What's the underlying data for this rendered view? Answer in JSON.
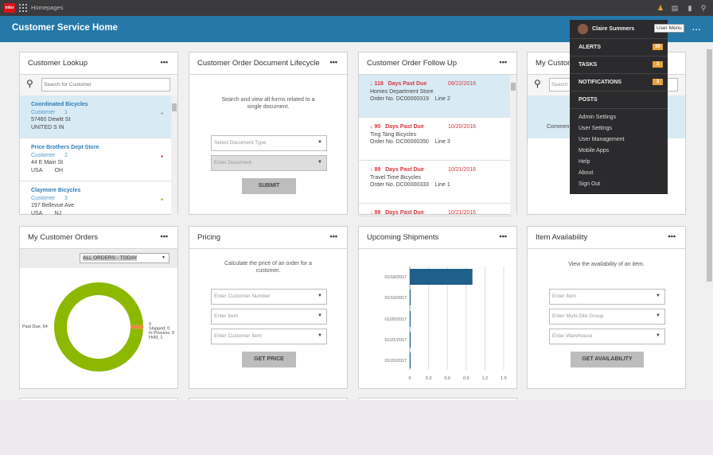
{
  "topbar": {
    "logo": "infor",
    "app_label": "Homepages",
    "icons": [
      "user-icon",
      "chat-icon",
      "bookmark-icon",
      "search-icon"
    ]
  },
  "header": {
    "title": "Customer Service Home",
    "more": "..."
  },
  "colors": {
    "header": "#2578a8",
    "topbar": "#3b3b3d",
    "accent": "#e8a33c",
    "donut_main": "#8cb800",
    "donut_hold": "#f08a3c",
    "bar": "#1f5f8b"
  },
  "cards": {
    "lookup": {
      "title": "Customer Lookup",
      "search_placeholder": "Search for Customer",
      "items": [
        {
          "name": "Coordinated Bicycles",
          "type": "Customer",
          "num": "1",
          "addr": "57460 Dewitt St",
          "region": "UNITED S IN",
          "logo": "COORDINATED BICYCLES"
        },
        {
          "name": "Price Brothers Dept Store",
          "type": "Customer",
          "num": "2",
          "addr": "44 E Main St",
          "region": "USA        OH",
          "logo": "Price Brothers"
        },
        {
          "name": "Claymore Bicycles",
          "type": "Customer",
          "num": "3",
          "addr": "197 Bellevue Ave",
          "region": "USA        NJ",
          "logo": "Claymore BICYCLES"
        }
      ]
    },
    "lifecycle": {
      "title": "Customer Order Document Lifecycle",
      "desc": "Search and view all forms related to a single document.",
      "doc_type": "Select Document Type",
      "doc": "Enter Document",
      "submit": "SUBMIT"
    },
    "followup": {
      "title": "Customer Order Follow Up",
      "items": [
        {
          "days": "118",
          "label": "Days Past Due",
          "date": "09/22/2016",
          "customer": "Homes Department Store",
          "order": "Order No.  DC00000319",
          "line": "Line   2"
        },
        {
          "days": "90",
          "label": "Days Past Due",
          "date": "10/20/2016",
          "customer": "Ting Tang Bicycles",
          "order": "Order No.  DC00000350",
          "line": "Line   3"
        },
        {
          "days": "89",
          "label": "Days Past Due",
          "date": "10/21/2016",
          "customer": "Travel Time Bicycles",
          "order": "Order No.  DC00000333",
          "line": "Line   1"
        },
        {
          "days": "89",
          "label": "Days Past Due",
          "date": "10/21/2016"
        }
      ]
    },
    "mycust": {
      "title": "My Custom",
      "search": "Search",
      "comment": "Commen"
    },
    "orders": {
      "title": "My Customer Orders",
      "filter": "ALL ORDERS - TODAY"
    },
    "pricing": {
      "title": "Pricing",
      "desc": "Calculate the price of an order for a customer.",
      "f1": "Enter Customer Number",
      "f2": "Enter Item",
      "f3": "Enter Customer Item",
      "button": "GET PRICE"
    },
    "shipments": {
      "title": "Upcoming Shipments"
    },
    "avail": {
      "title": "Item Availability",
      "desc": "View the availability of an item.",
      "f1": "Enter Item",
      "f2": "Enter Multi-Site Group",
      "f3": "Enter Warehouse",
      "button": "GET AVAILABILITY"
    }
  },
  "user_menu": {
    "name": "Claire Summers",
    "tooltip": "User Menu",
    "sections": [
      {
        "label": "ALERTS",
        "count": "30"
      },
      {
        "label": "TASKS",
        "count": "3"
      },
      {
        "label": "NOTIFICATIONS",
        "count": "3"
      },
      {
        "label": "POSTS"
      }
    ],
    "links": [
      "Admin Settings",
      "User Settings",
      "User Management",
      "Mobile Apps",
      "Help",
      "About",
      "Sign Out"
    ]
  },
  "chart_data": [
    {
      "type": "pie",
      "donut": true,
      "slices": [
        {
          "label": "Past Due, 64",
          "value": 64
        },
        {
          "label": "0",
          "value": 0
        },
        {
          "label": "Shipped, 0",
          "value": 0
        },
        {
          "label": "In Process, 0",
          "value": 0
        },
        {
          "label": "Hold, 1",
          "value": 1
        }
      ]
    },
    {
      "type": "bar",
      "orientation": "horizontal",
      "categories": [
        "01/18/2017",
        "01/19/2017",
        "01/20/2017",
        "01/21/2017",
        "01/22/2017"
      ],
      "values": [
        1,
        0,
        0,
        0,
        0
      ],
      "xticks": [
        "0",
        "0.3",
        "0.6",
        "0.9",
        "1.2",
        "1.5"
      ],
      "xlim": [
        0,
        1.5
      ],
      "grid": true
    }
  ]
}
